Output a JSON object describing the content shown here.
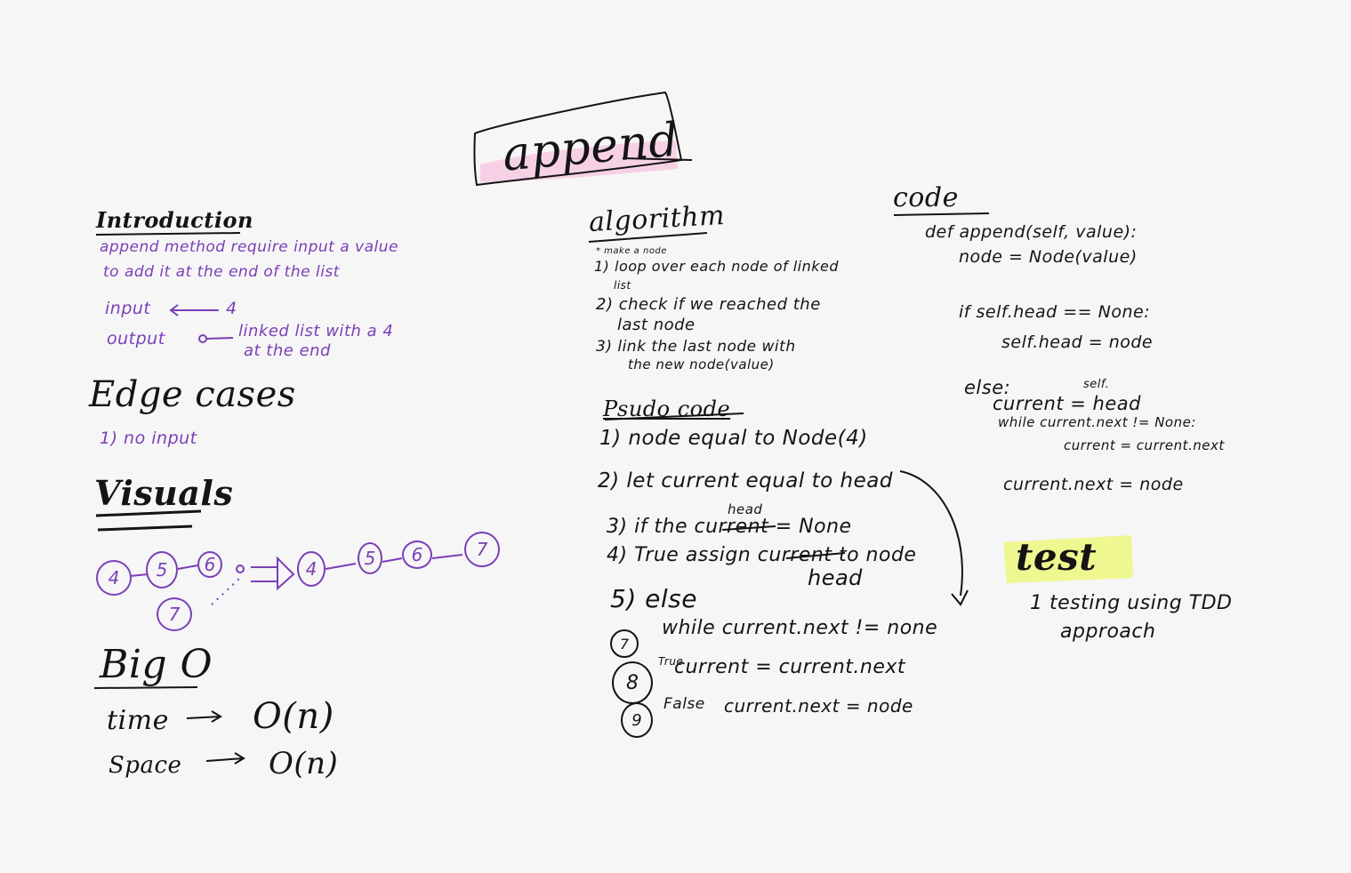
{
  "title": "append",
  "introduction": {
    "heading": "Introduction",
    "line1": "append method require input a value",
    "line2": "to add it at the end of the list",
    "input_label": "input",
    "input_value": "4",
    "output_label": "output",
    "output_value1": "linked list with a 4",
    "output_value2": "at the end"
  },
  "edge_cases": {
    "heading": "Edge cases",
    "item1": "1) no input"
  },
  "visuals": {
    "heading": "Visuals",
    "before": [
      "4",
      "5",
      "6"
    ],
    "new_node": "7",
    "after": [
      "4",
      "5",
      "6",
      "7"
    ]
  },
  "big_o": {
    "heading": "Big O",
    "time_label": "time",
    "time_value": "O(n)",
    "space_label": "Space",
    "space_value": "O(n)"
  },
  "algorithm": {
    "heading": "algorithm",
    "note": "* make a node",
    "step1a": "1) loop over each node of linked",
    "step1b": "list",
    "step2a": "2) check if we reached the",
    "step2b": "last node",
    "step3a": "3) link the last node with",
    "step3b": "the new node(value)"
  },
  "pseudo": {
    "heading": "Psudo code",
    "s1": "1) node equal to Node(4)",
    "s2": "2) let current equal to head",
    "s3_head": "head",
    "s3": "3) if the current = None",
    "s4": "4) True  assign current to node",
    "s4_head": "head",
    "s5": "5) else",
    "s7": "while  current.next != none",
    "s8_true": "True",
    "s8": "current = current.next",
    "s9_false": "False",
    "s9": "current.next = node",
    "n7": "7",
    "n8": "8",
    "n9": "9"
  },
  "code": {
    "heading": "code",
    "l1": "def append(self, value):",
    "l2": "node = Node(value)",
    "l3": "if self.head == None:",
    "l4": "self.head = node",
    "l5": "else:",
    "l6_self": "self.",
    "l6": "current = head",
    "l7": "while  current.next != None:",
    "l8": "current = current.next",
    "l9": "current.next = node"
  },
  "test": {
    "heading": "test",
    "item1": "1 testing using TDD",
    "item1b": "approach"
  },
  "colors": {
    "background": "#f6f6f6",
    "ink": "#141414",
    "purple": "#7a3fb7",
    "pink_highlight": "#f6cfe4",
    "yellow_highlight": "#eef78a"
  }
}
